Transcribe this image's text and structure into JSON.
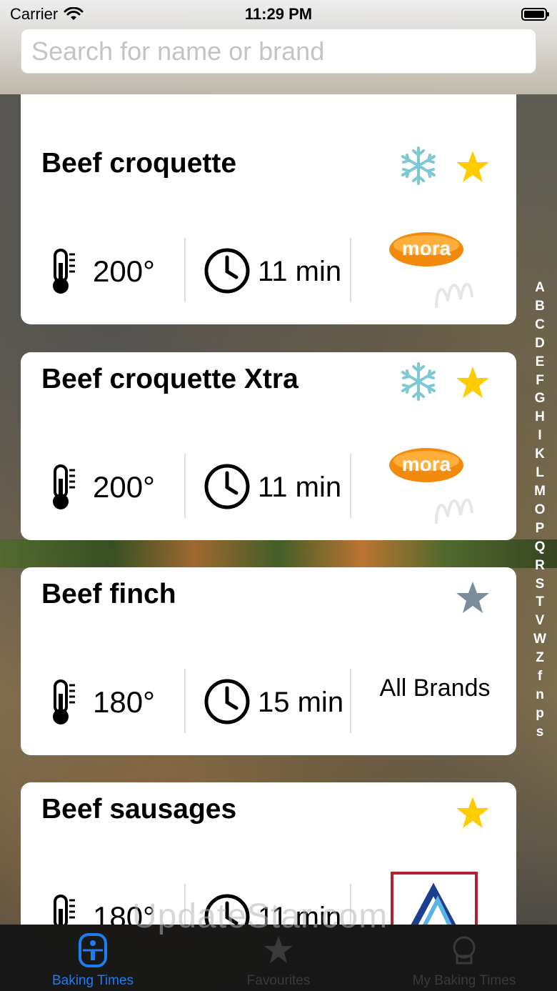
{
  "status_bar": {
    "carrier": "Carrier",
    "time": "11:29 PM"
  },
  "search": {
    "placeholder": "Search for name or brand"
  },
  "items": [
    {
      "name": "Beef croquette",
      "frozen": true,
      "favourite": true,
      "temperature": "200°",
      "time": "11 min",
      "brand_logo": "mora",
      "brand_text": ""
    },
    {
      "name": "Beef croquette Xtra",
      "frozen": true,
      "favourite": true,
      "temperature": "200°",
      "time": "11 min",
      "brand_logo": "mora",
      "brand_text": ""
    },
    {
      "name": "Beef finch",
      "frozen": false,
      "favourite": false,
      "temperature": "180°",
      "time": "15 min",
      "brand_logo": "",
      "brand_text": "All Brands"
    },
    {
      "name": "Beef sausages",
      "frozen": false,
      "favourite": true,
      "temperature": "180°",
      "time": "11 min",
      "brand_logo": "aldi",
      "brand_text": ""
    }
  ],
  "alphabet_index": [
    "A",
    "B",
    "C",
    "D",
    "E",
    "F",
    "G",
    "H",
    "I",
    "K",
    "L",
    "M",
    "O",
    "P",
    "Q",
    "R",
    "S",
    "T",
    "V",
    "W",
    "Z",
    "f",
    "n",
    "p",
    "s"
  ],
  "tabs": [
    {
      "label": "Baking Times",
      "icon": "airfryer-icon",
      "active": true
    },
    {
      "label": "Favourites",
      "icon": "star-icon",
      "active": false
    },
    {
      "label": "My Baking Times",
      "icon": "chef-icon",
      "active": false
    }
  ],
  "watermark": "UpdateStar.com",
  "colors": {
    "accent": "#1e7cf2",
    "star_active": "#ffcc00",
    "star_inactive": "#7b8c9b",
    "snowflake": "#7ec8d4",
    "tab_inactive": "#3a3a3a"
  }
}
